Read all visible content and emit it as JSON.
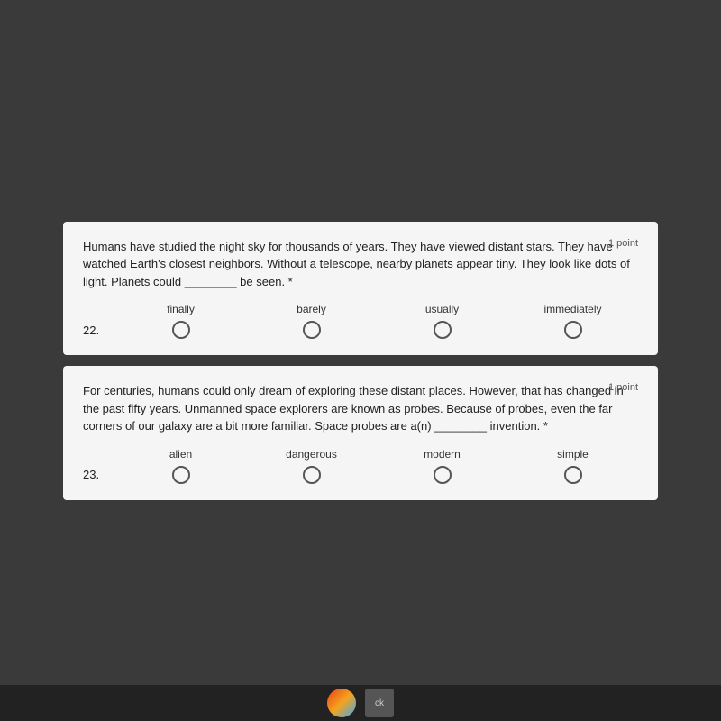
{
  "questions": [
    {
      "id": "q22",
      "number": "22.",
      "point_label": "1 point",
      "text": "Humans have studied the night sky for thousands of years. They have viewed distant stars. They have watched Earth's closest neighbors. Without a telescope, nearby planets appear tiny. They look like dots of light. Planets could ________ be seen. *",
      "options": [
        "finally",
        "barely",
        "usually",
        "immediately"
      ],
      "selected": null
    },
    {
      "id": "q23",
      "number": "23.",
      "point_label": "1 point",
      "text": "For centuries, humans could only dream of exploring these distant places. However, that has changed in the past fifty years. Unmanned space explorers are known as probes. Because of probes, even the far corners of our galaxy are a bit more familiar. Space probes are a(n) ________ invention. *",
      "options": [
        "alien",
        "dangerous",
        "modern",
        "simple"
      ],
      "selected": null
    }
  ]
}
